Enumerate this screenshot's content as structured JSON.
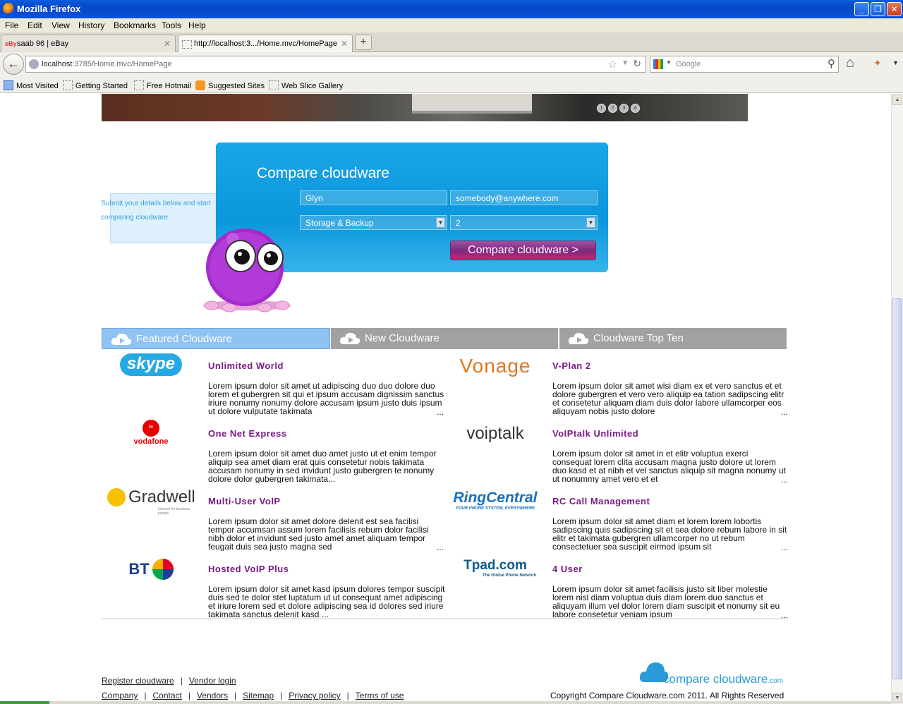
{
  "window": {
    "title": "Mozilla Firefox"
  },
  "menu": [
    "File",
    "Edit",
    "View",
    "History",
    "Bookmarks",
    "Tools",
    "Help"
  ],
  "tabs": [
    {
      "label": "saab 96 | eBay",
      "favicon": "ebay"
    },
    {
      "label": "http://localhost:3.../Home.mvc/HomePage",
      "favicon": "blank"
    }
  ],
  "address": {
    "host": "localhost",
    "path": ":3785/Home.mvc/HomePage"
  },
  "search": {
    "placeholder": "Google"
  },
  "bookmarks": [
    "Most Visited",
    "Getting Started",
    "Free Hotmail",
    "Suggested Sites",
    "Web Slice Gallery"
  ],
  "slider": {
    "dots": [
      "1",
      "2",
      "3",
      "4"
    ]
  },
  "compare": {
    "title": "Compare cloudware",
    "name_value": "Glyn",
    "email_value": "somebody@anywhere.com",
    "category_value": "Storage & Backup",
    "quantity_value": "2",
    "button_label": "Compare cloudware >"
  },
  "hint": {
    "text": "Submit your details below and start comparing cloudware"
  },
  "categories": [
    "Featured Cloudware",
    "New Cloudware",
    "Cloudware Top Ten"
  ],
  "products": [
    {
      "logo": "skype",
      "name": "Unlimited World",
      "desc": "Lorem ipsum dolor sit amet ut adipiscing duo duo dolore duo lorem et gubergren sit qui et ipsum accusam dignissim sanctus iriure nonumy nonumy dolore accusam ipsum justo duis ipsum ut dolore vulputate takimata"
    },
    {
      "logo": "vonage",
      "name": "V-Plan 2",
      "desc": "Lorem ipsum dolor sit amet wisi diam ex et vero sanctus et et dolore gubergren et vero vero aliquip ea tation sadipscing elitr et consetetur aliquam diam duis dolor labore ullamcorper eos aliquyam nobis justo dolore"
    },
    {
      "logo": "vodafone",
      "name": "One Net Express",
      "desc": "Lorem ipsum dolor sit amet duo amet justo ut et enim tempor aliquip sea amet diam erat quis consetetur nobis takimata accusam nonumy in sed invidunt justo gubergren te nonumy dolore dolor gubergren takimata..."
    },
    {
      "logo": "voiptalk",
      "name": "VoIPtalk Unlimited",
      "desc": "Lorem ipsum dolor sit amet in et elitr voluptua exerci consequat lorem clita accusam magna justo dolore ut lorem duo kasd et at nibh et vel sanctus aliquip sit magna nonumy ut ut nonummy amet vero et et"
    },
    {
      "logo": "gradwell",
      "name": "Multi-User VoIP",
      "desc": "Lorem ipsum dolor sit amet dolore delenit est sea facilisi tempor accumsan assum lorem facilisis rebum dolor facilisi nibh dolor et invidunt sed justo amet amet aliquam tempor feugait duis sea justo magna sed"
    },
    {
      "logo": "ringcentral",
      "name": "RC Call Management",
      "desc": "Lorem ipsum dolor sit amet diam et lorem lorem lobortis sadipscing quis sadipscing sit et sea dolore rebum labore in sit elitr et takimata gubergren ullamcorper no ut rebum consectetuer sea suscipit eirmod ipsum sit"
    },
    {
      "logo": "bt",
      "name": "Hosted VoIP Plus",
      "desc": "Lorem ipsum dolor sit amet kasd ipsum dolores tempor suscipit duis sed te dolor stet luptatum ut ut consequat amet adipiscing et iriure lorem sed et dolore adipiscing sea id dolores sed iriure takimata sanctus delenit kasd ..."
    },
    {
      "logo": "tpad",
      "name": "4 User",
      "desc": "Lorem ipsum dolor sit amet facilisis justo sit liber molestie lorem nisl diam voluptua duis diam lorem duo sanctus et aliquyam illum vel dolor lorem diam suscipit et nonumy sit eu labore consetetur veniam ipsum"
    }
  ],
  "logos": {
    "skype": "skype",
    "vonage": "Vonage",
    "vodafone": "vodafone",
    "voiptalk": "voiptalk",
    "gradwell": "Gradwell",
    "gradwell_tag": "Internet for business people",
    "ringcentral": "RingCentral",
    "ringcentral_tag": "YOUR PHONE SYSTEM, EVERYWHERE",
    "bt": "BT",
    "tpad": "Tpad.com",
    "tpad_tag": "The Global Phone Network"
  },
  "footer": {
    "register": "Register cloudware",
    "vendor_login": "Vendor login",
    "links": [
      "Company",
      "Contact",
      "Vendors",
      "Sitemap",
      "Privacy policy",
      "Terms of use"
    ],
    "copyright": "Copyright Compare Cloudware.com 2011. All Rights Reserved",
    "brand_main": "compare cloudware",
    "brand_suffix": ".com"
  },
  "colors": {
    "accent_blue": "#0c96dc",
    "product_name": "#7b1a87",
    "button": "#7d2a82"
  }
}
